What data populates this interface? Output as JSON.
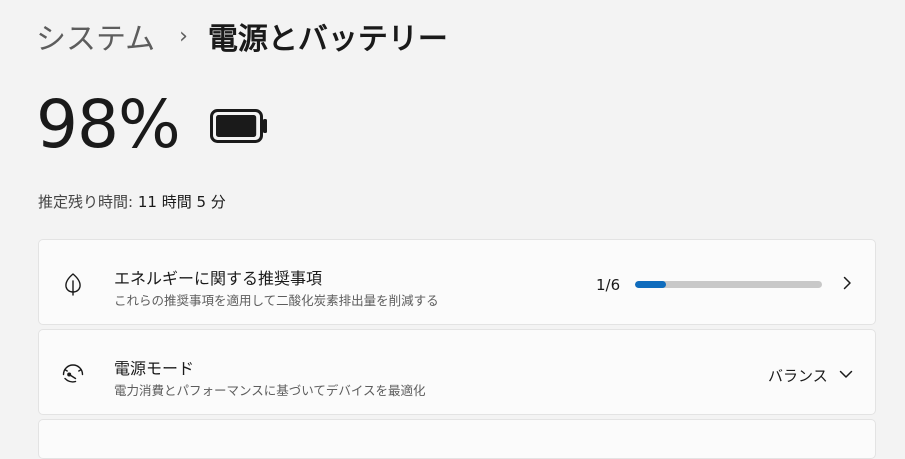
{
  "header": {
    "breadcrumb_parent": "システム",
    "breadcrumb_separator": "›",
    "breadcrumb_current": "電源とバッテリー"
  },
  "battery": {
    "percent_text": "98%",
    "level": 0.98,
    "remaining_label": "推定残り時間:",
    "remaining_value": "11 時間 5 分"
  },
  "energy_card": {
    "title": "エネルギーに関する推奨事項",
    "subtitle": "これらの推奨事項を適用して二酸化炭素排出量を削減する",
    "progress_text": "1/6",
    "progress_fraction": 0.1667,
    "icon": "leaf-icon"
  },
  "power_mode_card": {
    "title": "電源モード",
    "subtitle": "電力消費とパフォーマンスに基づいてデバイスを最適化",
    "value": "バランス",
    "icon": "gauge-icon"
  },
  "colors": {
    "accent": "#0f6cbd",
    "background": "#f3f3f3",
    "card": "#fbfbfb"
  }
}
